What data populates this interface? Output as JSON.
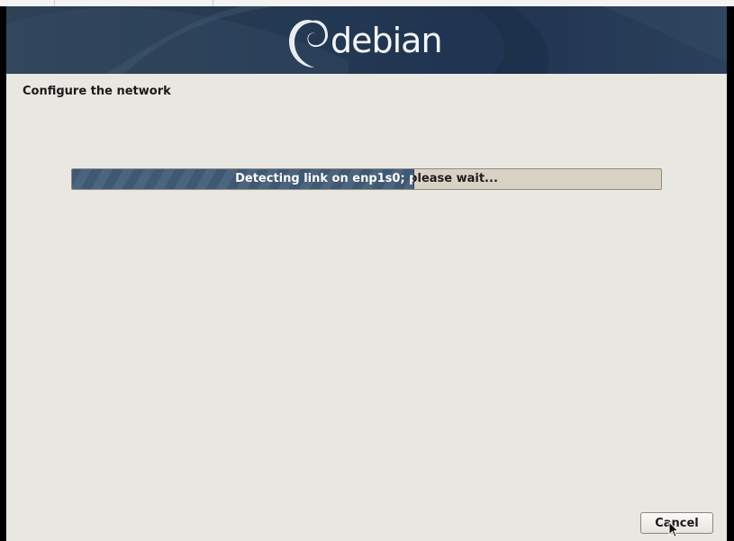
{
  "installer": {
    "brand": "debian",
    "page_title": "Configure the network",
    "progress": {
      "label": "Detecting link on enp1s0; please wait...",
      "fraction": 0.58
    },
    "buttons": {
      "cancel": "Cancel"
    }
  },
  "colors": {
    "banner": "#253a52",
    "panel": "#e9e7e1",
    "progress_fill": "#3f5873",
    "progress_track": "#d8d2c5"
  },
  "icons": [
    "debian-swirl-logo-icon",
    "mouse-pointer-icon"
  ]
}
